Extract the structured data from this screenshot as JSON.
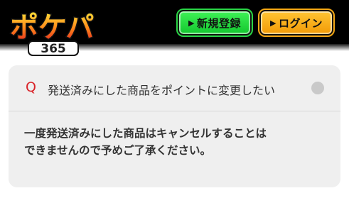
{
  "header": {
    "logo_text": "ポケパ",
    "logo_sub": "365",
    "register_label": "新規登録",
    "login_label": "ログイン",
    "arrow_icon": "triangle-right-icon"
  },
  "faq": {
    "q_mark": "Q",
    "question": "発送済みにした商品をポイントに変更したい",
    "answer_lines": [
      "一度発送済みにした商品はキャンセルすることは",
      "できませんので予めご了承ください。"
    ]
  },
  "colors": {
    "header_bg": "#000000",
    "register_green": "#20d93c",
    "login_orange": "#f7ab14",
    "q_red": "#d9242a",
    "card_bg": "#efefef"
  }
}
